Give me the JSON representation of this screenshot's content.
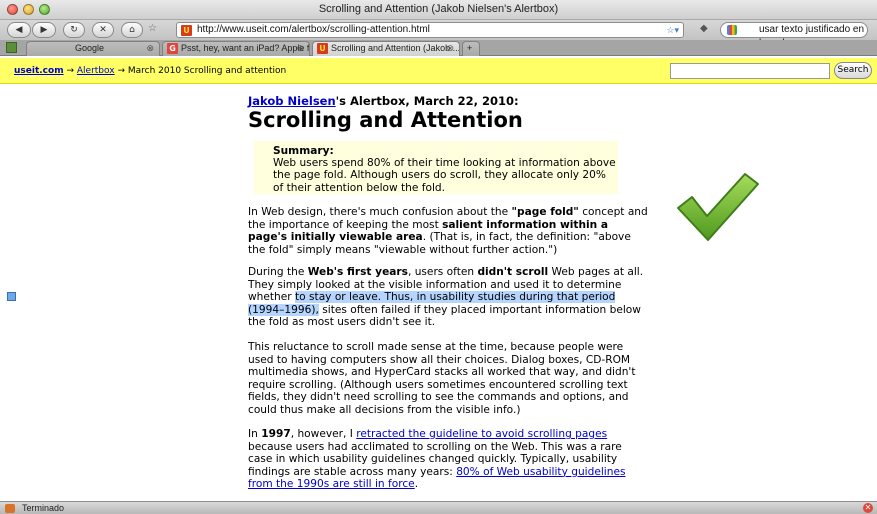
{
  "window": {
    "title": "Scrolling and Attention (Jakob Nielsen's Alertbox)"
  },
  "toolbar": {
    "back_icon": "back-arrow-icon",
    "forward_icon": "forward-arrow-icon",
    "reload_icon": "reload-icon",
    "stop_icon": "stop-icon",
    "home_icon": "home-icon",
    "url": "http://www.useit.com/alertbox/scrolling-attention.html",
    "search_text": "usar texto justificado en la web"
  },
  "tabs": [
    {
      "label": "Google",
      "active": false
    },
    {
      "label": "Psst, hey, want an iPad? Apple f...",
      "active": false
    },
    {
      "label": "Scrolling and Attention (Jakob ...",
      "active": true
    }
  ],
  "pagebar": {
    "site_link": "useit.com",
    "arrow1": "→",
    "alertbox_link": "Alertbox",
    "arrow2": "→",
    "current": "March 2010 Scrolling and attention",
    "search_button": "Search"
  },
  "article": {
    "author_link": "Jakob Nielsen",
    "byline_rest": "'s Alertbox, March 22, 2010:",
    "headline": "Scrolling and Attention",
    "summary_label": "Summary:",
    "summary_text": "Web users spend 80% of their time looking at information above the page fold. Although users do scroll, they allocate only 20% of their attention below the fold.",
    "p1_a": "In Web design, there's much confusion about the ",
    "p1_b": "\"page fold\"",
    "p1_c": " concept and the importance of keeping the most ",
    "p1_d": "salient information within a page's initially viewable area",
    "p1_e": ". (That is, in fact, the definition: \"above the fold\" simply means \"viewable without further action.\")",
    "p2_a": "During the ",
    "p2_b": "Web's first years",
    "p2_c": ", users often ",
    "p2_d": "didn't scroll",
    "p2_e": " Web pages at all. They simply looked at the visible information and used it to determine whether ",
    "p2_hl": "to stay or leave. Thus, in usability studies during that period (1994–1996),",
    "p2_f": " sites often failed if they placed important information below the fold as most users didn't see it.",
    "p3": "This reluctance to scroll made sense at the time, because people were used to having computers show all their choices. Dialog boxes, CD-ROM multimedia shows, and HyperCard stacks all worked that way, and didn't require scrolling. (Although users sometimes encountered scrolling text fields, they didn't need scrolling to see the commands and options, and could thus make all decisions from the visible info.)",
    "p4_a": "In ",
    "p4_b": "1997",
    "p4_c": ", however, I ",
    "p4_link1": "retracted the guideline to avoid scrolling pages",
    "p4_d": " because users had acclimated to scrolling on the Web. This was a rare case in which usability guidelines changed quickly. Typically, usability findings are stable across many years: ",
    "p4_link2": "80% of Web usability guidelines from the 1990s are still in force",
    "p4_e": "."
  },
  "status": {
    "text": "Terminado"
  },
  "colors": {
    "pagebar_bg": "#ffff66",
    "summary_bg": "#ffffdd",
    "link": "#0000cc",
    "highlight": "#b5d5ff",
    "checkmark": "#7bc142"
  }
}
